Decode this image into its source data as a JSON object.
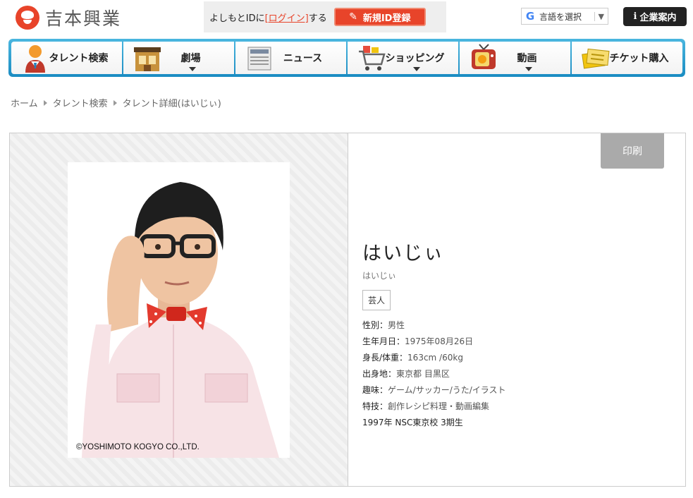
{
  "header": {
    "logo_text": "吉本興業",
    "login_prefix": "よしもとIDに",
    "login_link": "[ログイン]",
    "login_suffix": "する",
    "register_label": "新規ID登録",
    "translate_label": "言語を選択",
    "translate_arrow": "▼",
    "corporate_label": "企業案内"
  },
  "nav": {
    "items": [
      {
        "label": "タレント検索",
        "icon": "talent-icon",
        "has_dropdown": false
      },
      {
        "label": "劇場",
        "icon": "theater-icon",
        "has_dropdown": true
      },
      {
        "label": "ニュース",
        "icon": "news-icon",
        "has_dropdown": false
      },
      {
        "label": "ショッピング",
        "icon": "cart-icon",
        "has_dropdown": true
      },
      {
        "label": "動画",
        "icon": "tv-icon",
        "has_dropdown": true
      },
      {
        "label": "チケット購入",
        "icon": "ticket-icon",
        "has_dropdown": false
      }
    ]
  },
  "breadcrumb": [
    "ホーム",
    "タレント検索",
    "タレント詳細(はいじぃ)"
  ],
  "profile": {
    "print_label": "印刷",
    "photo_credit": "©YOSHIMOTO KOGYO CO.,LTD.",
    "name": "はいじぃ",
    "kana": "はいじぃ",
    "tag": "芸人",
    "details": [
      {
        "label": "性別：",
        "value": "男性"
      },
      {
        "label": "生年月日：",
        "value": "1975年08月26日"
      },
      {
        "label": "身長/体重：",
        "value": "163cm /60kg"
      },
      {
        "label": "出身地：",
        "value": "東京都 目黒区"
      },
      {
        "label": "趣味：",
        "value": "ゲーム/サッカー/うた/イラスト"
      },
      {
        "label": "特技：",
        "value": "創作レシピ料理・動画編集"
      },
      {
        "label": "",
        "value": "1997年 NSC東京校 3期生"
      }
    ]
  },
  "colors": {
    "brand": "#e8442a",
    "nav_blue": "#1a8cc2"
  }
}
